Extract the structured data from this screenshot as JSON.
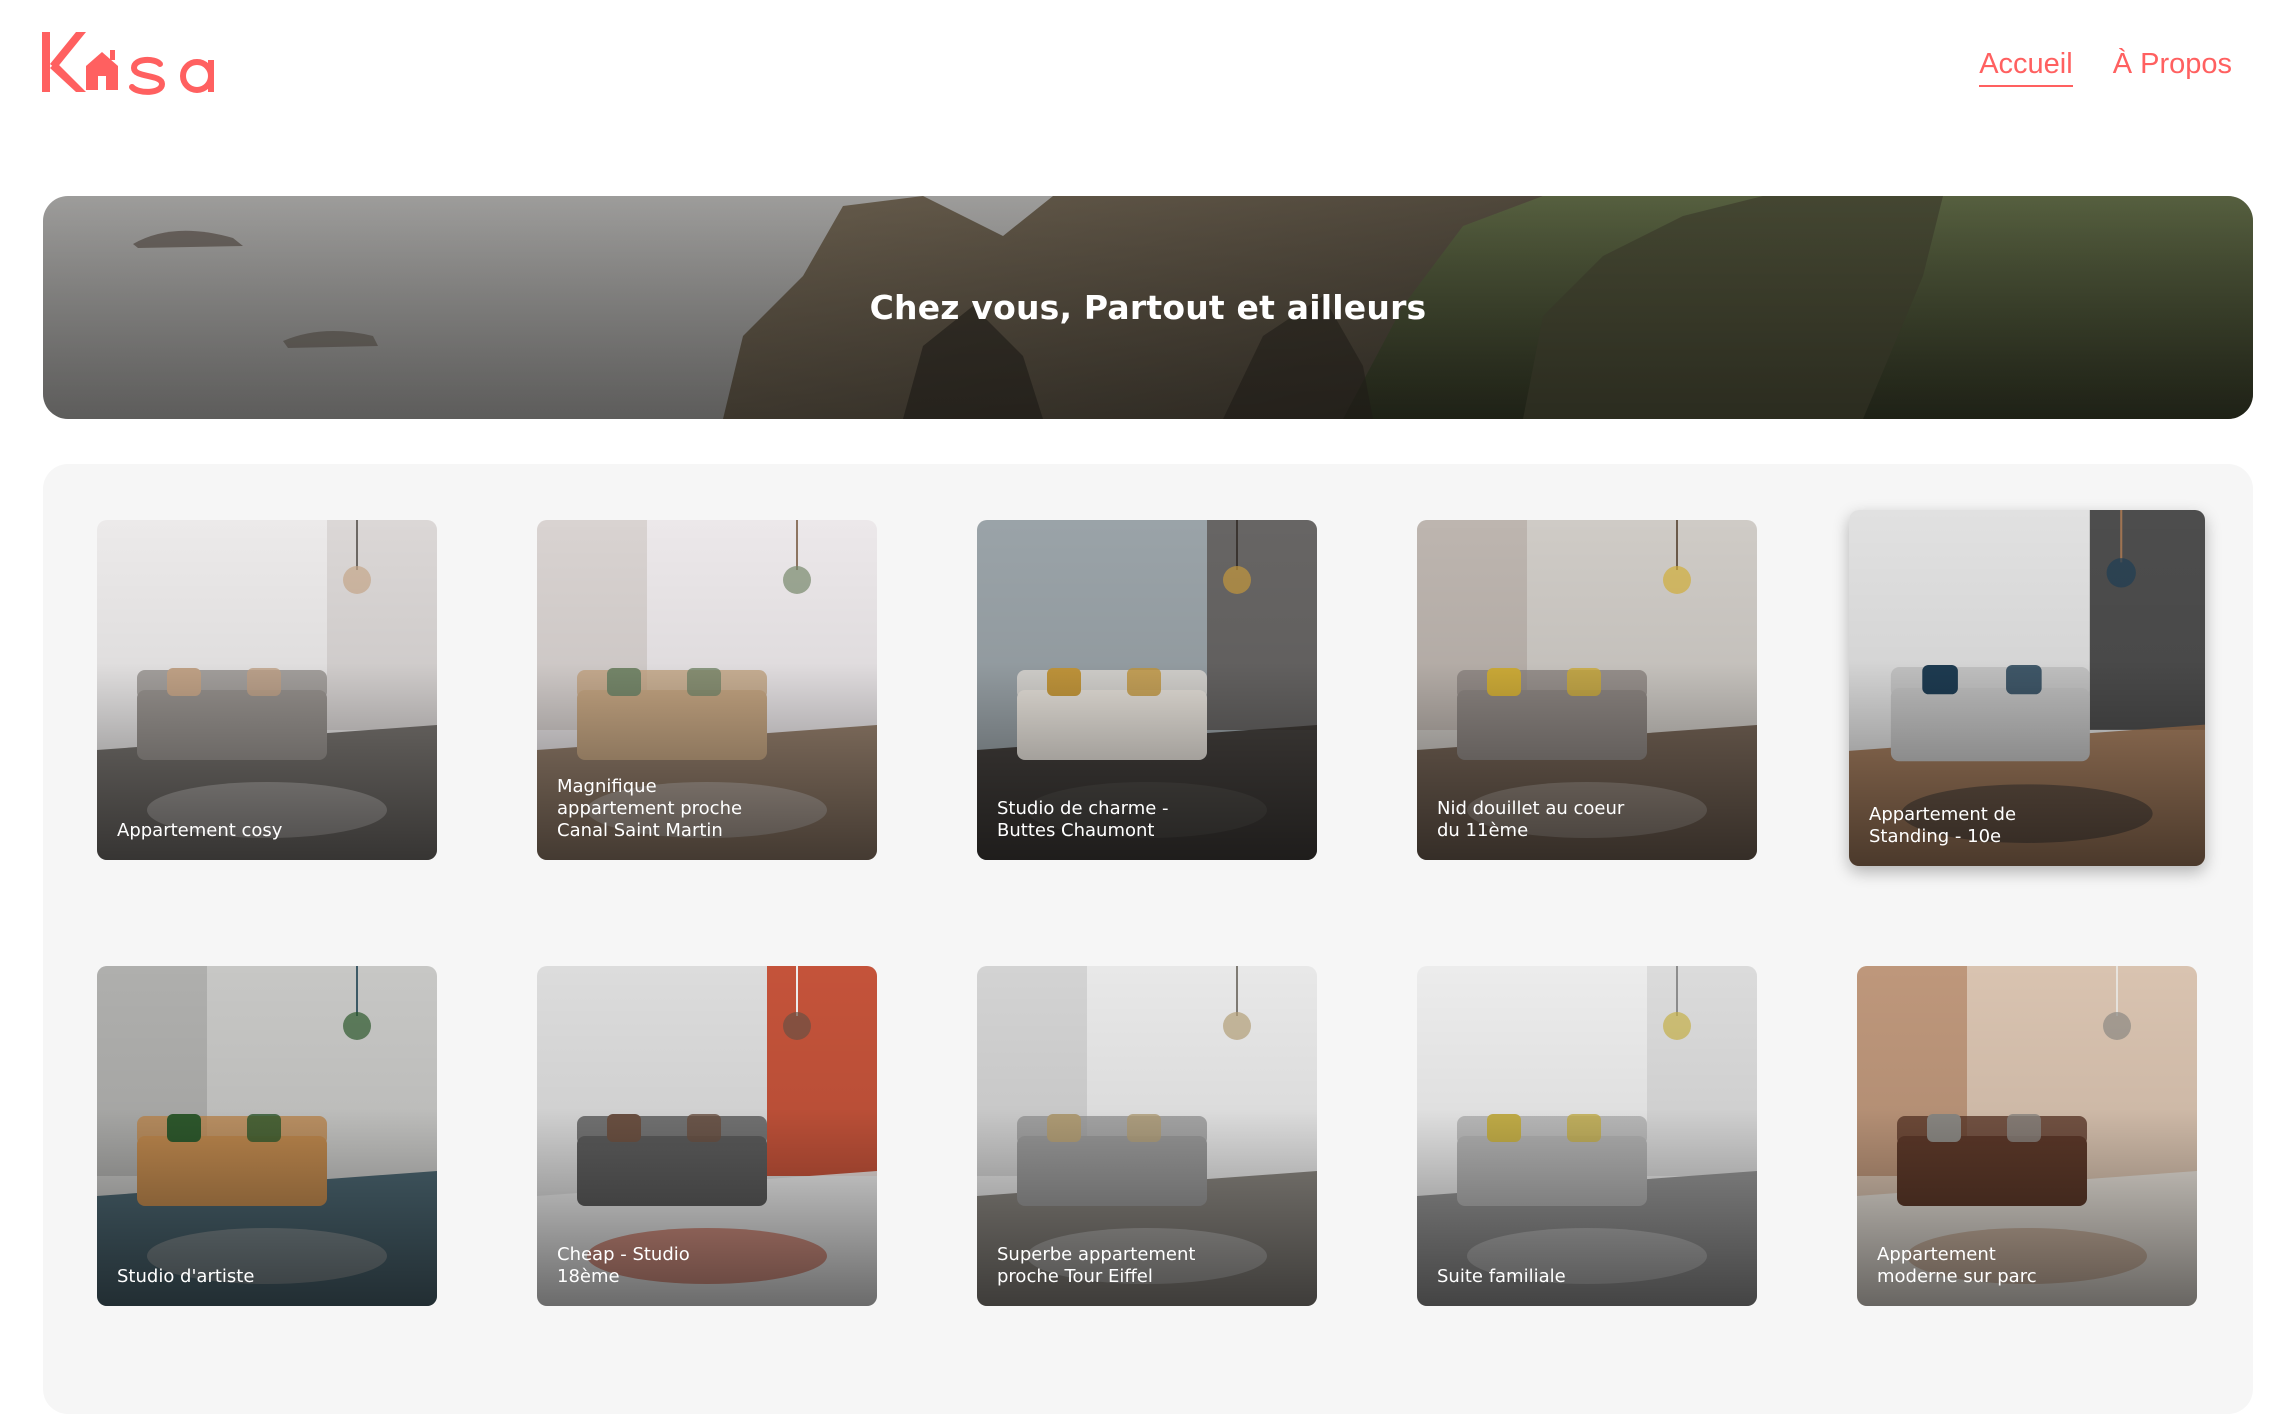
{
  "brand": {
    "logo_text": "Kasa",
    "color": "#ff6060"
  },
  "nav": {
    "home_label": "Accueil",
    "about_label": "À Propos"
  },
  "banner": {
    "title": "Chez vous, Partout et ailleurs"
  },
  "gallery": {
    "background": "#f6f6f6",
    "cards": [
      {
        "title": "Appartement cosy",
        "palette": [
          "#eceaea",
          "#d8d4d2",
          "#9a9591",
          "#6d6864",
          "#c9a98c"
        ]
      },
      {
        "title": "Magnifique appartement proche Canal Saint Martin",
        "palette": [
          "#ece8ea",
          "#d6cfcc",
          "#c9a985",
          "#8e7561",
          "#7a8c6e"
        ]
      },
      {
        "title": "Studio de charme - Buttes Chaumont",
        "palette": [
          "#9aa3a8",
          "#5e5b58",
          "#e9e4dd",
          "#3b3531",
          "#c79a3d"
        ]
      },
      {
        "title": "Nid douillet au coeur du 11ème",
        "palette": [
          "#cfcbc6",
          "#bab2aa",
          "#8e8783",
          "#6b5a4a",
          "#d4b13a"
        ]
      },
      {
        "title": "Appartement de Standing - 10e",
        "palette": [
          "#e1e1e1",
          "#333333",
          "#c6c6c6",
          "#a07452",
          "#1f3e55"
        ]
      },
      {
        "title": "Studio d'artiste",
        "palette": [
          "#c7c7c5",
          "#aaaaa8",
          "#c18a4f",
          "#3d5a66",
          "#2f5b2e"
        ]
      },
      {
        "title": "Cheap - Studio 18ème",
        "palette": [
          "#dcdcdc",
          "#bf3b1d",
          "#5d5d5d",
          "#eeeeee",
          "#6e5344"
        ]
      },
      {
        "title": "Superbe appartement proche Tour Eiffel",
        "palette": [
          "#e8e8e8",
          "#cfcfcf",
          "#9b9b9b",
          "#7f7b74",
          "#b6a27a"
        ]
      },
      {
        "title": "Suite familiale",
        "palette": [
          "#ececec",
          "#d8d8d8",
          "#b5b5b5",
          "#8d8d8d",
          "#c9b34a"
        ]
      },
      {
        "title": "Appartement moderne sur parc",
        "palette": [
          "#d9c3b0",
          "#b88f72",
          "#5e3a2a",
          "#e8e4de",
          "#8e8b86"
        ]
      }
    ]
  }
}
